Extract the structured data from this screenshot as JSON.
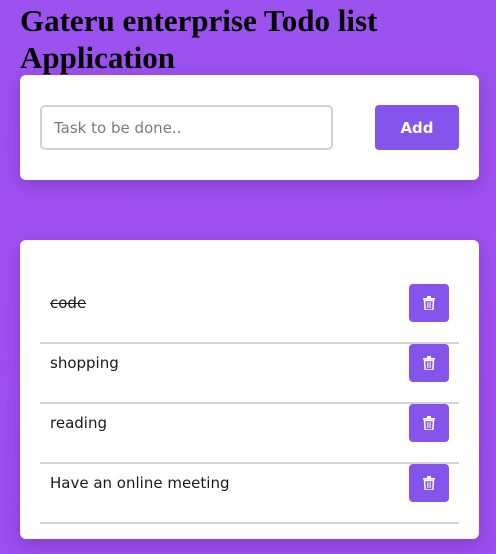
{
  "header": {
    "title": "Gateru enterprise Todo list Application"
  },
  "form": {
    "input_value": "",
    "placeholder": "Task to be done..",
    "add_label": "Add"
  },
  "todos": [
    {
      "text": "code",
      "completed": true
    },
    {
      "text": "shopping",
      "completed": false
    },
    {
      "text": "reading",
      "completed": false
    },
    {
      "text": "Have an online meeting",
      "completed": false
    }
  ],
  "icons": {
    "delete": "trash-icon"
  },
  "colors": {
    "accent": "#8554ea",
    "background": "#9f50f1",
    "card": "#ffffff"
  }
}
